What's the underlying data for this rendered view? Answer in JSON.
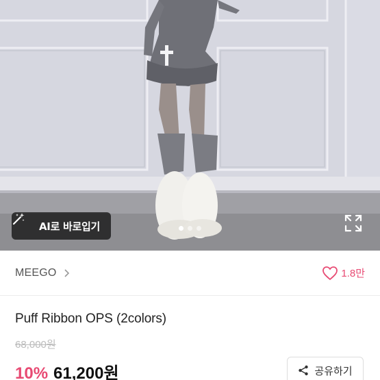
{
  "photo": {
    "ai_button_label": "AI로 바로입기",
    "icons": {
      "wand": "magic-wand-icon",
      "expand": "expand-icon"
    },
    "page_indicator": {
      "total": 3,
      "active": 1
    }
  },
  "brand": {
    "name": "MEEGO",
    "like_count": "1.8만",
    "accent_color": "#e84a73"
  },
  "product": {
    "title": "Puff Ribbon OPS (2colors)",
    "original_price": "68,000원",
    "discount": "10%",
    "price": "61,200원"
  },
  "actions": {
    "share_label": "공유하기"
  }
}
